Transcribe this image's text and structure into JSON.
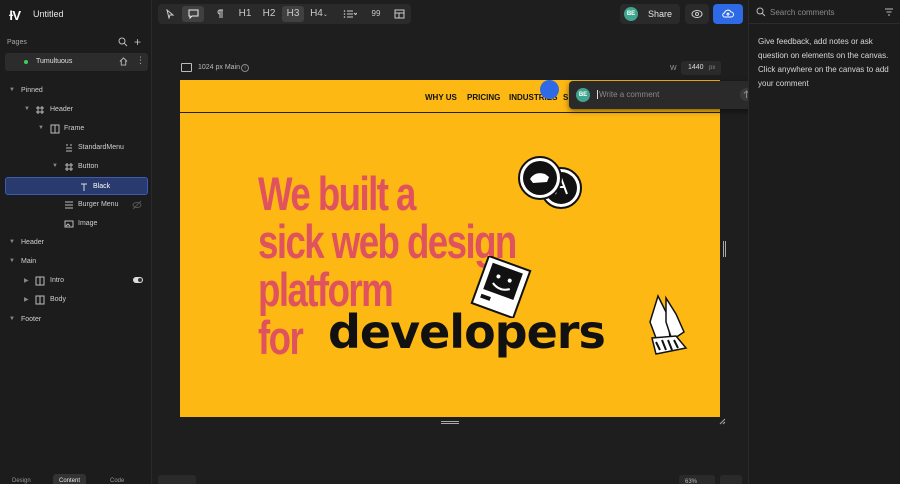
{
  "app": {
    "logo": "ɫV",
    "document_title": "Untitled"
  },
  "pages": {
    "label": "Pages",
    "items": [
      {
        "name": "Tumultuous"
      }
    ]
  },
  "tree": [
    {
      "label": "Pinned"
    },
    {
      "label": "Header"
    },
    {
      "label": "Frame"
    },
    {
      "label": "StandardMenu"
    },
    {
      "label": "Button"
    },
    {
      "label": "Black"
    },
    {
      "label": "Burger Menu"
    },
    {
      "label": "Image"
    },
    {
      "label": "Header"
    },
    {
      "label": "Main"
    },
    {
      "label": "Intro"
    },
    {
      "label": "Body"
    },
    {
      "label": "Footer"
    }
  ],
  "bottom_tabs": [
    "Design",
    "Content",
    "Code"
  ],
  "toolbar": {
    "h1": "H1",
    "h2": "H2",
    "h3": "H3",
    "h4": "H4",
    "quote": "99"
  },
  "header": {
    "avatar": "BE",
    "share_label": "Share"
  },
  "canvas": {
    "breakpoint_label": "1024 px Main",
    "width_label": "W",
    "width_value": "1440",
    "width_unit": "px",
    "zoom": "63%"
  },
  "site": {
    "nav": [
      "WHY US",
      "PRICING",
      "INDUSTRIES",
      "S"
    ],
    "hero_lines": [
      "We built a",
      "sick web design",
      "platform",
      "for"
    ],
    "hero_word": "developers"
  },
  "comment": {
    "avatar": "BE",
    "placeholder": "Write a comment"
  },
  "comments_panel": {
    "search_placeholder": "Search comments",
    "help": "Give feedback, add notes or ask question on elements on the canvas. Click anywhere on the canvas to add your comment"
  },
  "colors": {
    "accent": "#2e6ae6",
    "frame_bg": "#fdb813",
    "hero": "#e0525e"
  }
}
